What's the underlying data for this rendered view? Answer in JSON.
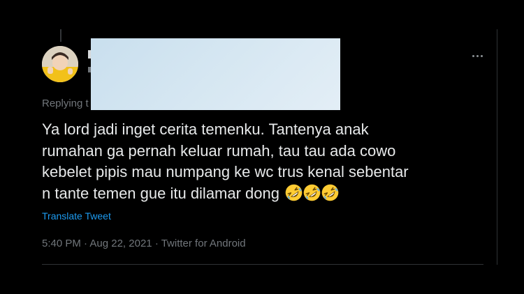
{
  "tweet": {
    "replying_label": "Replying t",
    "text_lines": [
      "Ya lord jadi inget cerita temenku. Tantenya anak",
      "rumahan ga pernah keluar rumah, tau tau ada cowo",
      "kebelet pipis mau numpang ke wc trus kenal sebentar",
      "n  tante temen gue itu dilamar dong"
    ],
    "emojis": [
      "rolling-on-floor-laughing",
      "rolling-on-floor-laughing",
      "rolling-on-floor-laughing"
    ],
    "translate_label": "Translate Tweet",
    "time": "5:40 PM",
    "separator": "·",
    "date": "Aug 22, 2021",
    "source": "Twitter for Android"
  },
  "colors": {
    "background": "#000000",
    "text": "#e7e9ea",
    "muted": "#71767b",
    "link": "#1d9bf0",
    "redaction": "#d6e7f2",
    "emoji_face": "#ffcc33"
  },
  "icons": {
    "more": "more-horizontal-icon",
    "avatar": "avatar-photo"
  }
}
